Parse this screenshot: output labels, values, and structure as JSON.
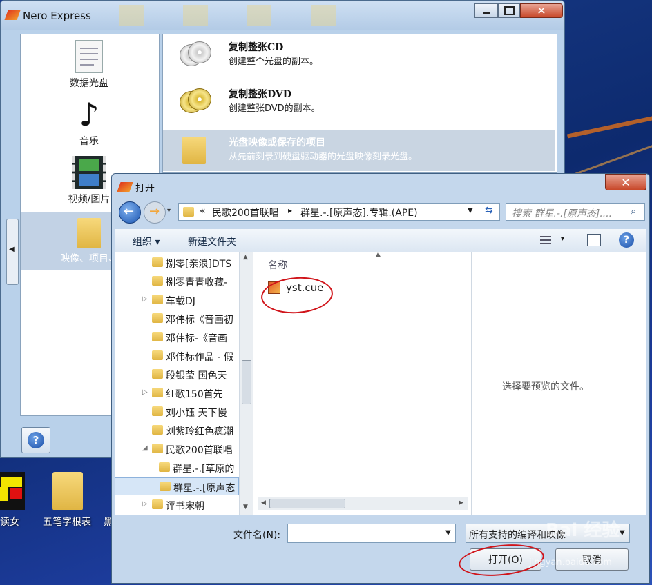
{
  "nero": {
    "title": "Nero Express",
    "categories": [
      {
        "label": "数据光盘"
      },
      {
        "label": "音乐"
      },
      {
        "label": "视频/图片"
      },
      {
        "label": "映像、项目、"
      }
    ],
    "options": [
      {
        "title": "复制整张CD",
        "desc": "创建整个光盘的副本。"
      },
      {
        "title": "复制整张DVD",
        "desc": "创建整张DVD的副本。"
      },
      {
        "title": "光盘映像或保存的项目",
        "desc": "从先前刻录到硬盘驱动器的光盘映像刻录光盘。"
      }
    ],
    "help_label": "?"
  },
  "desktop": {
    "icons": [
      {
        "label": "读女"
      },
      {
        "label": "五笔字根表"
      },
      {
        "label": "黑"
      }
    ]
  },
  "dialog": {
    "title": "打开",
    "breadcrumb": {
      "sep": "«",
      "part1": "民歌200首联唱",
      "arrow": "▸",
      "part2": "群星.-.[原声态].专辑.(APE)"
    },
    "search_placeholder": "搜索 群星.-.[原声态]....",
    "toolbar": {
      "organize": "组织 ▾",
      "new_folder": "新建文件夹"
    },
    "tree": [
      {
        "label": "捌零[亲浪]DTS"
      },
      {
        "label": "捌零青青收藏-"
      },
      {
        "label": "车载DJ"
      },
      {
        "label": "邓伟标《音画初"
      },
      {
        "label": "邓伟标-《音画"
      },
      {
        "label": "邓伟标作品 - 假"
      },
      {
        "label": "段银莹 国色天"
      },
      {
        "label": "红歌150首先"
      },
      {
        "label": "刘小钰 天下慢"
      },
      {
        "label": "刘紫玲红色疯潮"
      },
      {
        "label": "民歌200首联唱"
      },
      {
        "label": "群星.-.[草原的"
      },
      {
        "label": "群星.-.[原声态"
      },
      {
        "label": "评书宋朝"
      }
    ],
    "column_name": "名称",
    "file": {
      "name": "yst.cue"
    },
    "preview_text": "选择要预览的文件。",
    "filename_label": "文件名(N):",
    "filename_value": "",
    "filetype_value": "所有支持的编译和映像",
    "open_button": "打开(O)",
    "cancel_button": "取消",
    "watermark": "Bai 经验",
    "watermark_url": "jingyan.baidu.com"
  },
  "colors": {
    "selection": "#c9d5e2",
    "annotation": "#d0141a",
    "folder": "#e8c25a"
  }
}
